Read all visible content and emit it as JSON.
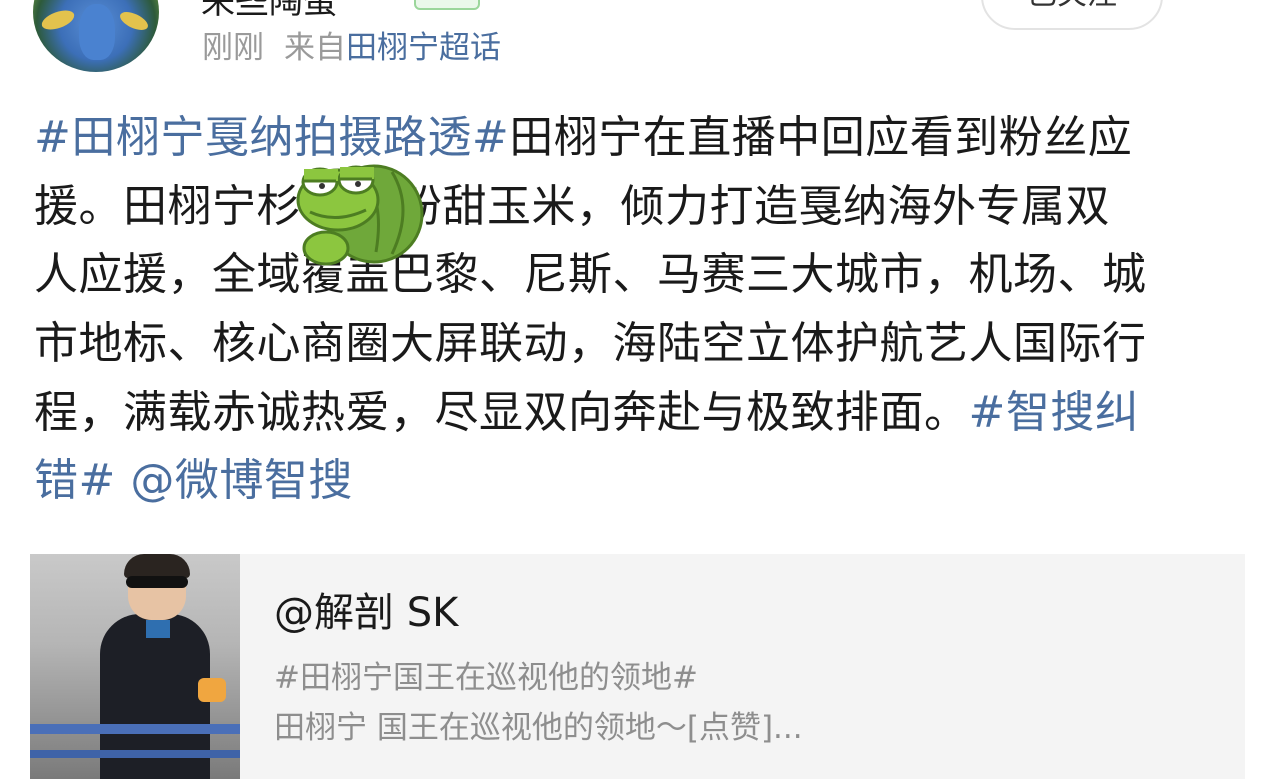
{
  "author": {
    "name": "来些陶蛋",
    "follow_label": "已关注"
  },
  "meta": {
    "time": "刚刚",
    "source_prefix": "来自",
    "source_link": "田栩宁超话"
  },
  "post": {
    "lines": [
      [
        {
          "text": "#田栩宁戛纳拍摄路透#",
          "tag": true
        },
        {
          "text": "田栩宁在直播中回应看到粉丝应",
          "tag": false
        }
      ],
      [
        {
          "text": "援。田栩宁杉",
          "tag": false
        },
        {
          "text": "",
          "tag": false
        },
        {
          "text": "P粉甜玉米，倾力打造戛纳海外专属双",
          "tag": false
        }
      ],
      [
        {
          "text": "人应援，全域覆盖巴黎、尼斯、马赛三大城市，机场、城",
          "tag": false
        }
      ],
      [
        {
          "text": "市地标、核心商圈大屏联动，海陆空立体护航艺人国际行",
          "tag": false
        }
      ],
      [
        {
          "text": "程，满载赤诚热爱，尽显双向奔赴与极致排面。",
          "tag": false
        },
        {
          "text": "#智搜纠",
          "tag": true
        }
      ],
      [
        {
          "text": "错#",
          "tag": true
        },
        {
          "text": " ",
          "tag": false
        },
        {
          "text": "@微博智搜",
          "tag": true
        }
      ]
    ]
  },
  "repost_card": {
    "title": "@解剖 SK",
    "desc_line1": "#田栩宁国王在巡视他的领地#",
    "desc_line2": "田栩宁 国王在巡视他的领地～[点赞]..."
  },
  "colors": {
    "link": "#4a6e9f",
    "meta_gray": "#9a9a9a",
    "card_bg": "#f4f4f4"
  }
}
